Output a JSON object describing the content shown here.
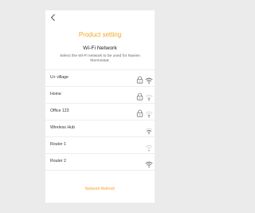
{
  "header": {
    "title": "Product setting",
    "heading": "Wi-Fi Network",
    "description": "Select the Wi-Fi network to be used for Navien thermostat."
  },
  "networks": [
    {
      "name": "U+ village",
      "locked": true,
      "signal": "strong"
    },
    {
      "name": "Home",
      "locked": true,
      "signal": "weak"
    },
    {
      "name": "Office 123",
      "locked": true,
      "signal": "weak"
    },
    {
      "name": "Wireless Hub",
      "locked": false,
      "signal": "medium"
    },
    {
      "name": "Router 1",
      "locked": false,
      "signal": "very-weak"
    },
    {
      "name": "Router 2",
      "locked": false,
      "signal": "strong"
    }
  ],
  "footer": {
    "refresh_label": "Network Refresh"
  },
  "colors": {
    "accent": "#f5a623",
    "background": "#ebebeb",
    "panel": "#ffffff"
  }
}
